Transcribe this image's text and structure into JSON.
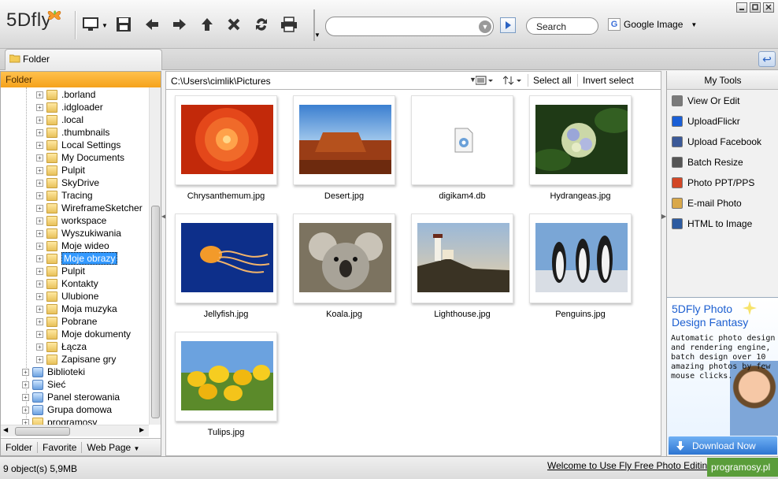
{
  "app": {
    "logo": "5Dfly"
  },
  "toolbar": {
    "address_value": "",
    "search_label": "Search",
    "engine_label": "Google Image",
    "engine_letter": "G"
  },
  "tabs": {
    "folder_tab": "Folder"
  },
  "left_panel": {
    "header": "Folder",
    "tree": [
      {
        "label": ".borland",
        "icon": "folder-icon",
        "indent": 2,
        "selected": false
      },
      {
        "label": ".idgloader",
        "icon": "folder-icon",
        "indent": 2,
        "selected": false
      },
      {
        "label": ".local",
        "icon": "folder-icon",
        "indent": 2,
        "selected": false
      },
      {
        "label": ".thumbnails",
        "icon": "folder-icon",
        "indent": 2,
        "selected": false
      },
      {
        "label": "Local Settings",
        "icon": "folder-icon",
        "indent": 2,
        "selected": false
      },
      {
        "label": "My Documents",
        "icon": "folder-icon",
        "indent": 2,
        "selected": false
      },
      {
        "label": "Pulpit",
        "icon": "folder-icon",
        "indent": 2,
        "selected": false
      },
      {
        "label": "SkyDrive",
        "icon": "folder-icon",
        "indent": 2,
        "selected": false
      },
      {
        "label": "Tracing",
        "icon": "folder-icon",
        "indent": 2,
        "selected": false
      },
      {
        "label": "WireframeSketcher",
        "icon": "folder-icon",
        "indent": 2,
        "selected": false
      },
      {
        "label": "workspace",
        "icon": "folder-icon",
        "indent": 2,
        "selected": false
      },
      {
        "label": "Wyszukiwania",
        "icon": "search-folder-icon",
        "indent": 2,
        "selected": false
      },
      {
        "label": "Moje wideo",
        "icon": "video-folder-icon",
        "indent": 2,
        "selected": false
      },
      {
        "label": "Moje obrazy",
        "icon": "pictures-folder-icon",
        "indent": 2,
        "selected": true
      },
      {
        "label": "Pulpit",
        "icon": "desktop-folder-icon",
        "indent": 2,
        "selected": false
      },
      {
        "label": "Kontakty",
        "icon": "contacts-folder-icon",
        "indent": 2,
        "selected": false
      },
      {
        "label": "Ulubione",
        "icon": "favorites-folder-icon",
        "indent": 2,
        "selected": false
      },
      {
        "label": "Moja muzyka",
        "icon": "music-folder-icon",
        "indent": 2,
        "selected": false
      },
      {
        "label": "Pobrane",
        "icon": "downloads-folder-icon",
        "indent": 2,
        "selected": false
      },
      {
        "label": "Moje dokumenty",
        "icon": "documents-folder-icon",
        "indent": 2,
        "selected": false
      },
      {
        "label": "Łącza",
        "icon": "links-folder-icon",
        "indent": 2,
        "selected": false
      },
      {
        "label": "Zapisane gry",
        "icon": "games-folder-icon",
        "indent": 2,
        "selected": false
      },
      {
        "label": "Biblioteki",
        "icon": "libraries-icon",
        "indent": 1,
        "selected": false
      },
      {
        "label": "Sieć",
        "icon": "network-icon",
        "indent": 1,
        "selected": false
      },
      {
        "label": "Panel sterowania",
        "icon": "control-panel-icon",
        "indent": 1,
        "selected": false
      },
      {
        "label": "Grupa domowa",
        "icon": "homegroup-icon",
        "indent": 1,
        "selected": false
      },
      {
        "label": "programosy",
        "icon": "folder-icon",
        "indent": 1,
        "selected": false
      }
    ],
    "bottom_tabs": [
      "Folder",
      "Favorite",
      "Web Page"
    ]
  },
  "center": {
    "path": "C:\\Users\\cimlik\\Pictures",
    "select_all": "Select all",
    "invert_select": "Invert select",
    "files": [
      {
        "name": "Chrysanthemum.jpg",
        "thumb": "chrysanthemum"
      },
      {
        "name": "Desert.jpg",
        "thumb": "desert"
      },
      {
        "name": "digikam4.db",
        "thumb": "db-file-icon"
      },
      {
        "name": "Hydrangeas.jpg",
        "thumb": "hydrangeas"
      },
      {
        "name": "Jellyfish.jpg",
        "thumb": "jellyfish"
      },
      {
        "name": "Koala.jpg",
        "thumb": "koala"
      },
      {
        "name": "Lighthouse.jpg",
        "thumb": "lighthouse"
      },
      {
        "name": "Penguins.jpg",
        "thumb": "penguins"
      },
      {
        "name": "Tulips.jpg",
        "thumb": "tulips"
      }
    ]
  },
  "right_panel": {
    "header": "My Tools",
    "tools": [
      {
        "label": "View Or Edit",
        "icon": "edit-icon",
        "color": "#7a7a7a"
      },
      {
        "label": "UploadFlickr",
        "icon": "flickr-icon",
        "color": "#1a5fd6"
      },
      {
        "label": "Upload Facebook",
        "icon": "facebook-icon",
        "color": "#3b5998"
      },
      {
        "label": "Batch Resize",
        "icon": "resize-icon",
        "color": "#555555"
      },
      {
        "label": "Photo PPT/PPS",
        "icon": "ppt-icon",
        "color": "#d24726"
      },
      {
        "label": "E-mail Photo",
        "icon": "email-icon",
        "color": "#d9a84a"
      },
      {
        "label": "HTML to Image",
        "icon": "html-image-icon",
        "color": "#2c5aa0"
      }
    ],
    "ad": {
      "title_line1": "5DFly Photo",
      "title_line2": "Design Fantasy",
      "text": "Automatic photo design and rendering engine, batch design over 10 amazing photos by few mouse clicks.",
      "button": "Download Now"
    }
  },
  "status": {
    "left": "9 object(s)  5,9MB",
    "right": "Welcome to Use Fly Free Photo Editing",
    "watermark": "programosy.pl"
  }
}
